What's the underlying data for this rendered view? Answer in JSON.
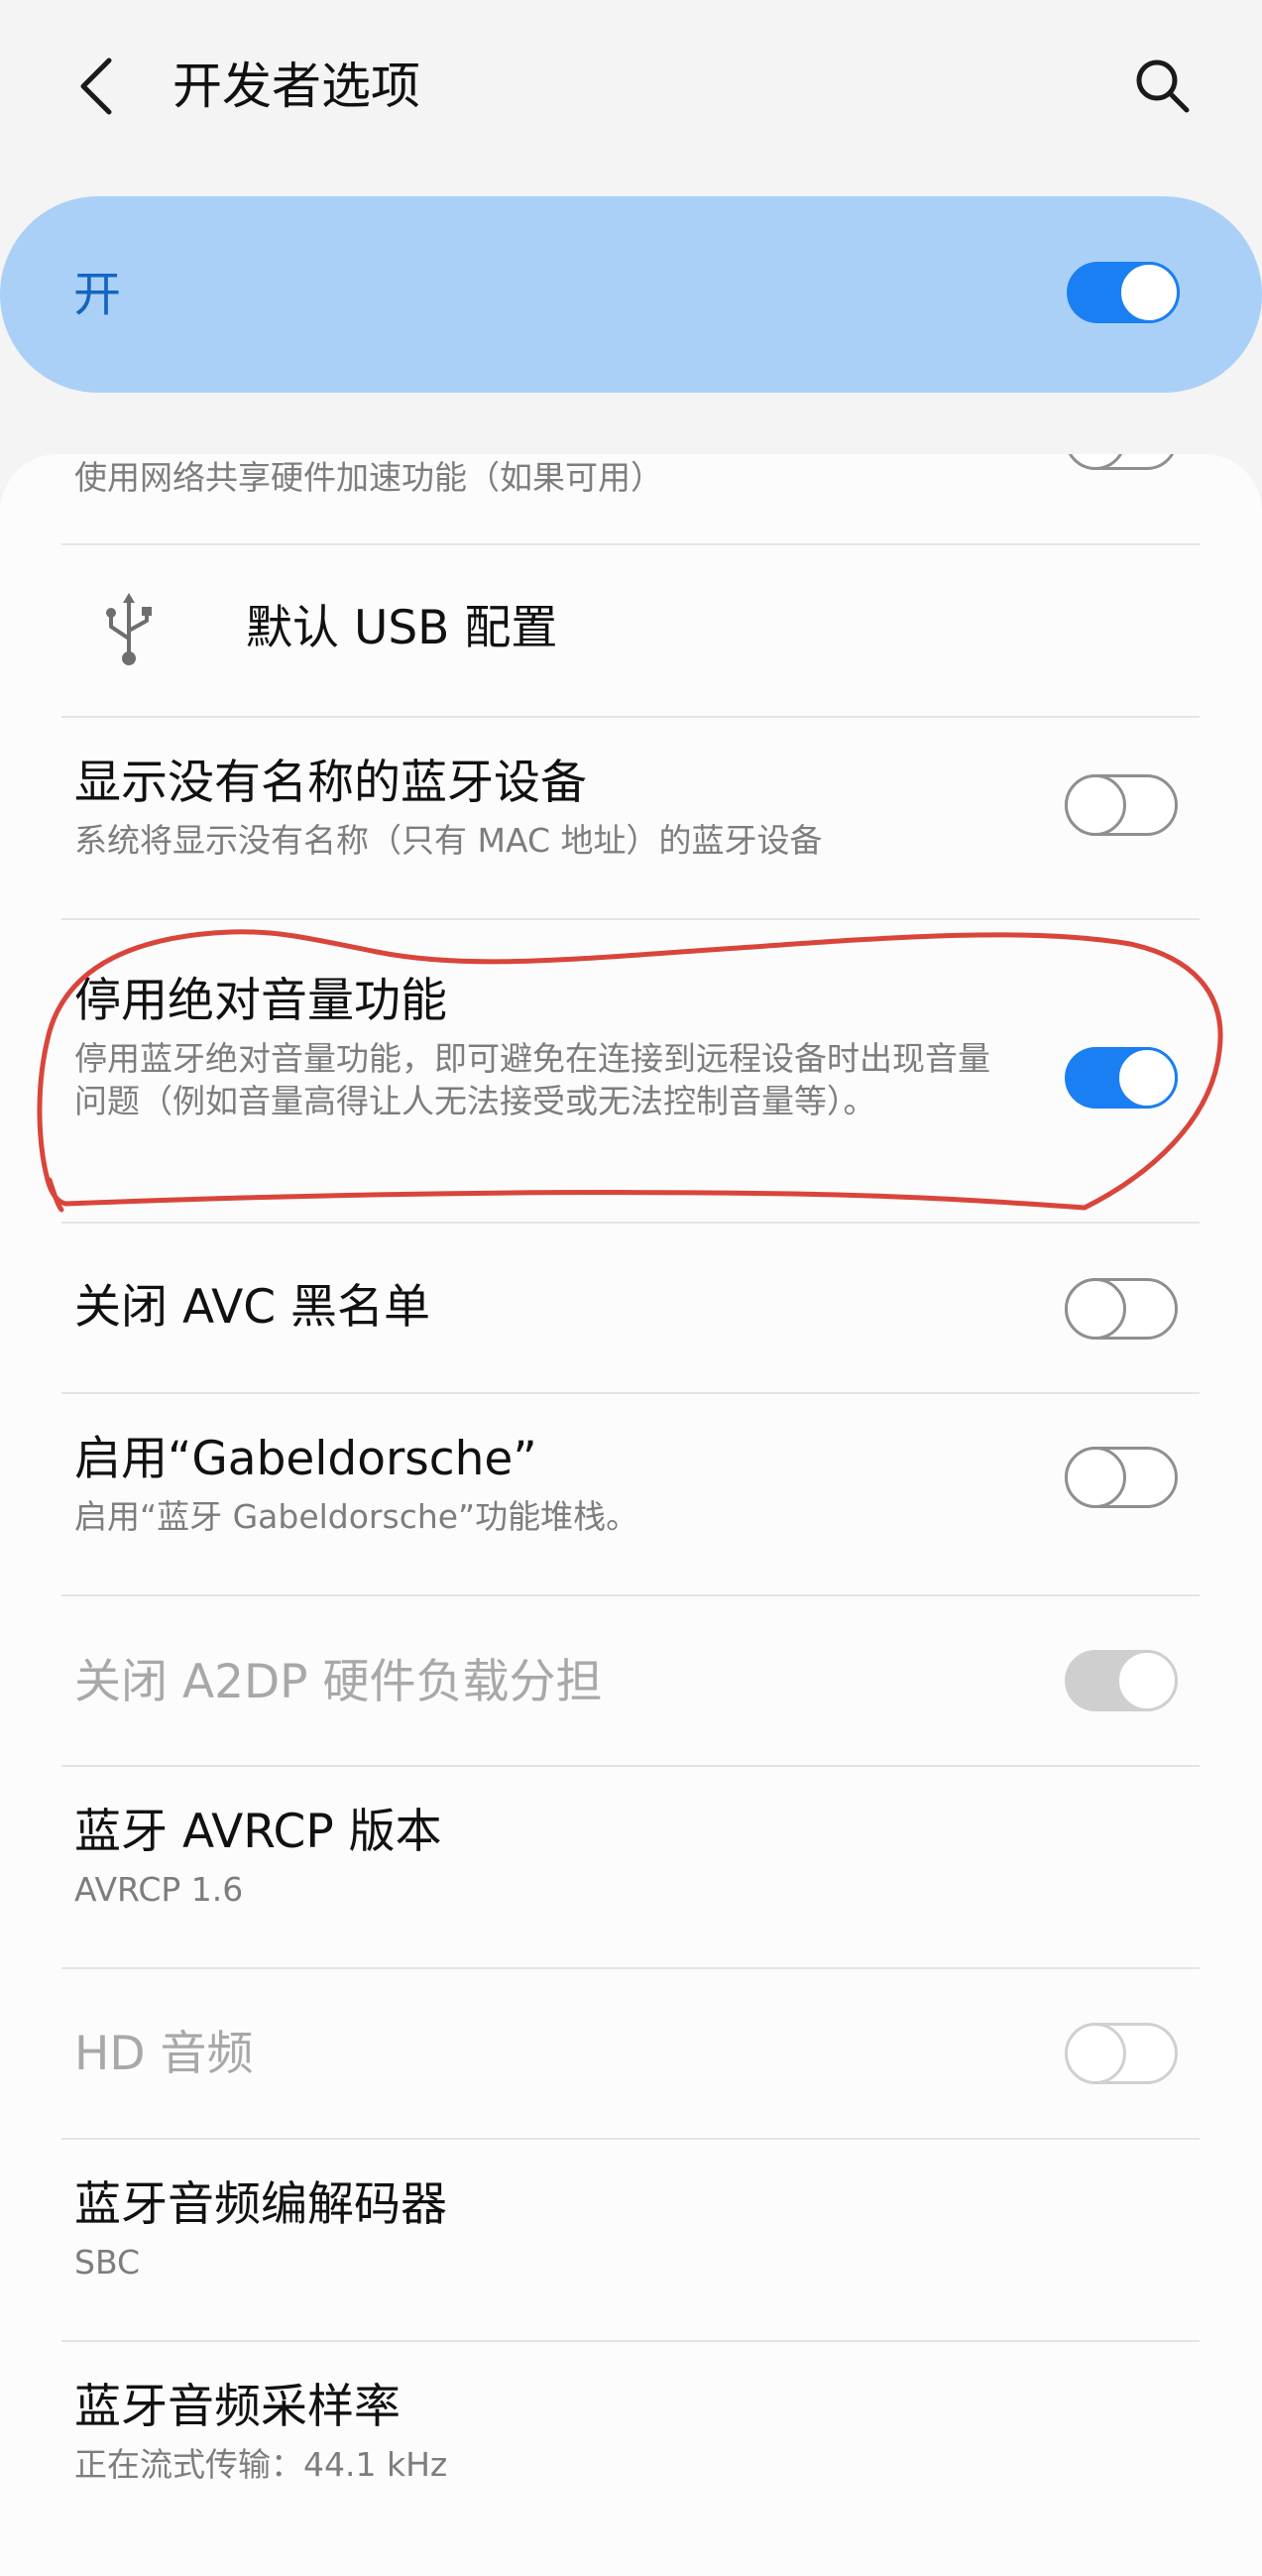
{
  "header": {
    "title": "开发者选项",
    "back_icon": "chevron-left-icon",
    "search_icon": "search-icon"
  },
  "master": {
    "label": "开",
    "state": "on"
  },
  "settings": [
    {
      "title": "",
      "subtitle": "使用网络共享硬件加速功能（如果可用）",
      "toggle": "off",
      "partial": true
    },
    {
      "title": "默认 USB 配置",
      "icon": "usb-icon"
    },
    {
      "title": "显示没有名称的蓝牙设备",
      "subtitle": "系统将显示没有名称（只有 MAC 地址）的蓝牙设备",
      "toggle": "off"
    },
    {
      "title": "停用绝对音量功能",
      "subtitle": "停用蓝牙绝对音量功能，即可避免在连接到远程设备时出现音量问题（例如音量高得让人无法接受或无法控制音量等）。",
      "toggle": "on",
      "highlighted": true
    },
    {
      "title": "关闭 AVC 黑名单",
      "toggle": "off"
    },
    {
      "title": "启用“Gabeldorsche”",
      "subtitle": "启用“蓝牙 Gabeldorsche”功能堆栈。",
      "toggle": "off"
    },
    {
      "title": "关闭 A2DP 硬件负载分担",
      "toggle": "on",
      "disabled": true
    },
    {
      "title": "蓝牙 AVRCP 版本",
      "subtitle": "AVRCP 1.6"
    },
    {
      "title": "HD 音频",
      "toggle": "off",
      "disabled": true
    },
    {
      "title": "蓝牙音频编解码器",
      "subtitle": "SBC"
    },
    {
      "title": "蓝牙音频采样率",
      "subtitle": "正在流式传输：44.1 kHz"
    }
  ],
  "colors": {
    "accent": "#1a7ff2",
    "banner": "#aad0f7",
    "annotation": "#d9453b"
  }
}
